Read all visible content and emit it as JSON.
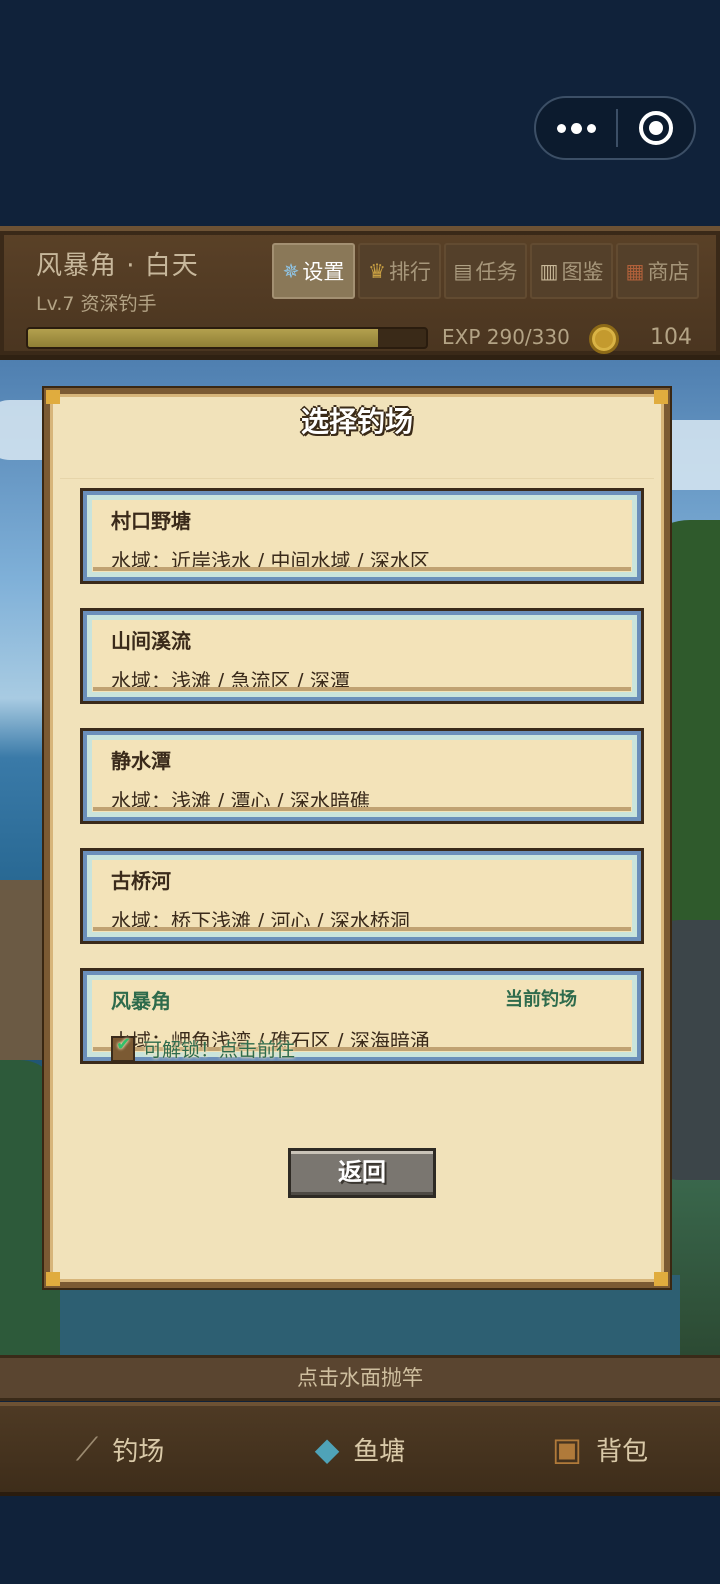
{
  "hud": {
    "location": "风暴角 · 白天",
    "level": "Lv.7 资深钓手",
    "tabs": [
      {
        "label": "设置",
        "icon": "gear-icon"
      },
      {
        "label": "排行",
        "icon": "crown-icon"
      },
      {
        "label": "任务",
        "icon": "scroll-icon"
      },
      {
        "label": "图鉴",
        "icon": "book-icon"
      },
      {
        "label": "商店",
        "icon": "shop-icon"
      }
    ],
    "exp_text": "EXP 290/330",
    "exp_progress": 0.879,
    "coins": "104"
  },
  "dialog": {
    "title": "选择钓场",
    "spots": [
      {
        "name": "村口野塘",
        "areas": "水域：近岸浅水 / 中间水域 / 深水区"
      },
      {
        "name": "山间溪流",
        "areas": "水域：浅滩 / 急流区 / 深潭"
      },
      {
        "name": "静水潭",
        "areas": "水域：浅滩 / 潭心 / 深水暗礁"
      },
      {
        "name": "古桥河",
        "areas": "水域：桥下浅滩 / 河心 / 深水桥洞"
      },
      {
        "name": "风暴角",
        "areas": "水域：岬角浅湾 / 礁石区 / 深海暗涌",
        "current_label": "当前钓场"
      }
    ],
    "unlock_hint": "可解锁！点击前往",
    "back_label": "返回"
  },
  "cast_hint": "点击水面抛竿",
  "nav": [
    {
      "label": "钓场",
      "icon": "fishing-rod-icon"
    },
    {
      "label": "鱼塘",
      "icon": "fish-icon"
    },
    {
      "label": "背包",
      "icon": "backpack-icon"
    }
  ],
  "colors": {
    "panel_bg": "#f1e2ba",
    "panel_border": "#7b5a33",
    "card_frame_blue": "#6b8fba",
    "current_green": "#2e6b4c"
  }
}
